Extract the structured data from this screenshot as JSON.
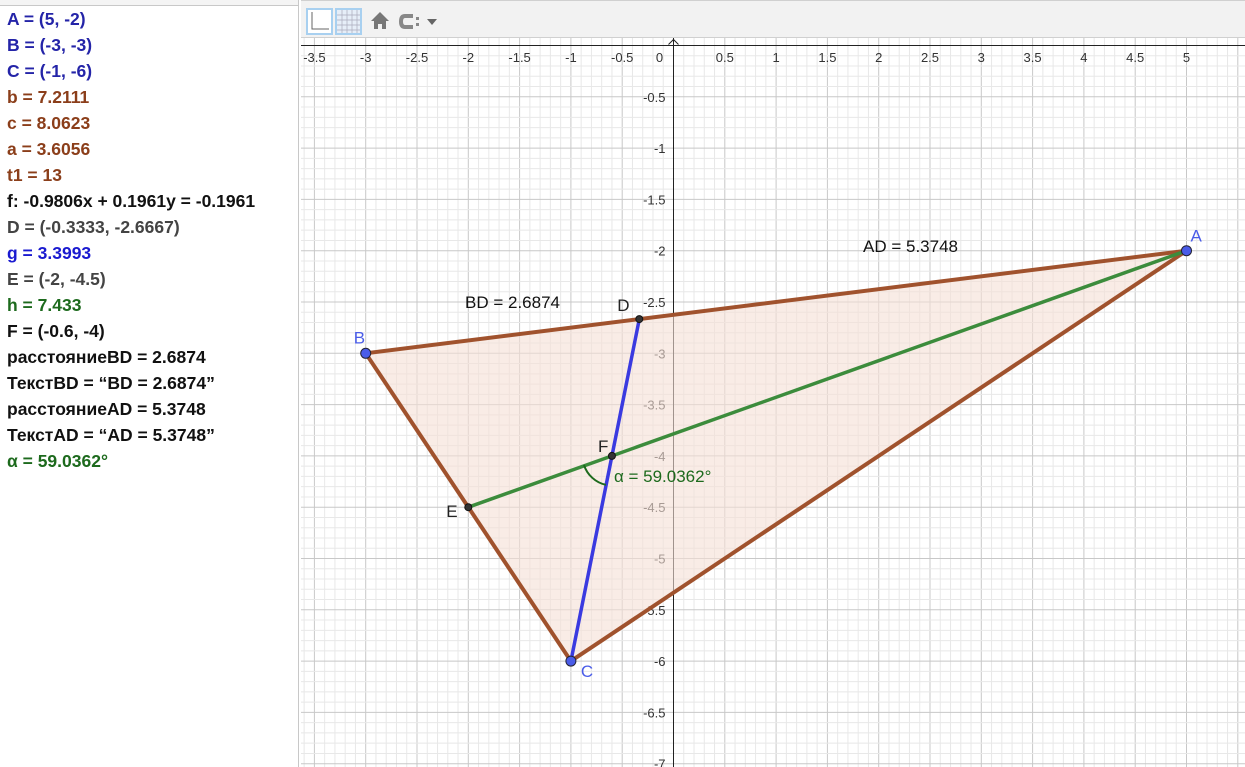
{
  "algebra": [
    {
      "text": "A = (5, -2)",
      "color": "#2424a8"
    },
    {
      "text": "B = (-3, -3)",
      "color": "#2424a8"
    },
    {
      "text": "C = (-1, -6)",
      "color": "#2424a8"
    },
    {
      "text": "b = 7.2111",
      "color": "#8b3e1a"
    },
    {
      "text": "c = 8.0623",
      "color": "#8b3e1a"
    },
    {
      "text": "a = 3.6056",
      "color": "#8b3e1a"
    },
    {
      "text": "t1 = 13",
      "color": "#8b3e1a"
    },
    {
      "text": "f: -0.9806x + 0.1961y = -0.1961",
      "color": "#111111"
    },
    {
      "text": "D = (-0.3333, -2.6667)",
      "color": "#444444"
    },
    {
      "text": "g = 3.3993",
      "color": "#1a1ad0"
    },
    {
      "text": "E = (-2, -4.5)",
      "color": "#444444"
    },
    {
      "text": "h = 7.433",
      "color": "#1d6a1d"
    },
    {
      "text": "F = (-0.6, -4)",
      "color": "#111111"
    },
    {
      "text": "расстояниеBD = 2.6874",
      "color": "#111111"
    },
    {
      "text": "ТекстBD = “BD = 2.6874”",
      "color": "#111111"
    },
    {
      "text": "расстояниеAD = 5.3748",
      "color": "#111111"
    },
    {
      "text": "ТекстAD = “AD = 5.3748”",
      "color": "#111111"
    },
    {
      "text": "α = 59.0362°",
      "color": "#1d6a1d"
    }
  ],
  "toolbar": {
    "buttons": [
      "axes-toggle",
      "grid-toggle",
      "home-view",
      "point-capture"
    ]
  },
  "graph": {
    "points": {
      "A": [
        5,
        -2
      ],
      "B": [
        -3,
        -3
      ],
      "C": [
        -1,
        -6
      ],
      "D": [
        -0.3333,
        -2.6667
      ],
      "E": [
        -2,
        -4.5
      ],
      "F": [
        -0.6,
        -4
      ]
    },
    "xticks": [
      "-3.5",
      "-3",
      "-2.5",
      "-2",
      "-1.5",
      "-1",
      "-0.5",
      "0",
      "0.5",
      "1",
      "1.5",
      "2",
      "2.5",
      "3",
      "3.5",
      "4",
      "4.5",
      "5"
    ],
    "yticks": [
      "-0.5",
      "-1",
      "-1.5",
      "-2",
      "-2.5",
      "-3",
      "-3.5",
      "-4",
      "-4.5",
      "-5",
      "-5.5",
      "-6",
      "-6.5",
      "-7"
    ],
    "labels": {
      "BD": "BD = 2.6874",
      "AD": "AD = 5.3748",
      "alpha": "α = 59.0362°"
    },
    "colors": {
      "triangle": "#a0522d",
      "fill": "#f5e0d6",
      "median": "#3a3ae0",
      "bisector": "#3c8c3c",
      "point": "#4a5ce8",
      "angle": "#1d6a1d"
    }
  }
}
